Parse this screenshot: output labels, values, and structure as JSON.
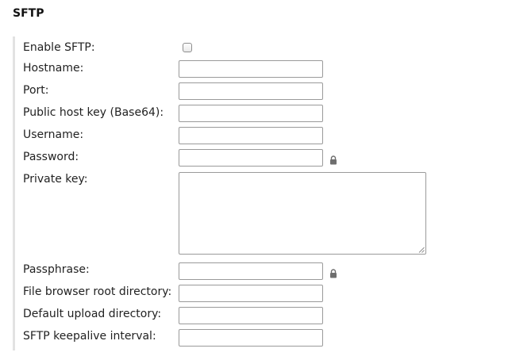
{
  "section_title": "SFTP",
  "fields": {
    "enable_sftp": {
      "label": "Enable SFTP:",
      "checked": false
    },
    "hostname": {
      "label": "Hostname:",
      "value": ""
    },
    "port": {
      "label": "Port:",
      "value": ""
    },
    "public_host_key": {
      "label": "Public host key (Base64):",
      "value": ""
    },
    "username": {
      "label": "Username:",
      "value": ""
    },
    "password": {
      "label": "Password:",
      "value": ""
    },
    "private_key": {
      "label": "Private key:",
      "value": ""
    },
    "passphrase": {
      "label": "Passphrase:",
      "value": ""
    },
    "file_browser_root": {
      "label": "File browser root directory:",
      "value": ""
    },
    "default_upload_dir": {
      "label": "Default upload directory:",
      "value": ""
    },
    "keepalive_interval": {
      "label": "SFTP keepalive interval:",
      "value": ""
    }
  },
  "icons": {
    "password_lock": "lock-icon",
    "passphrase_lock": "lock-icon"
  },
  "colors": {
    "section_border": "#e2e2e2",
    "input_border": "#9a9a9a",
    "lock_icon": "#6e6e6e"
  }
}
